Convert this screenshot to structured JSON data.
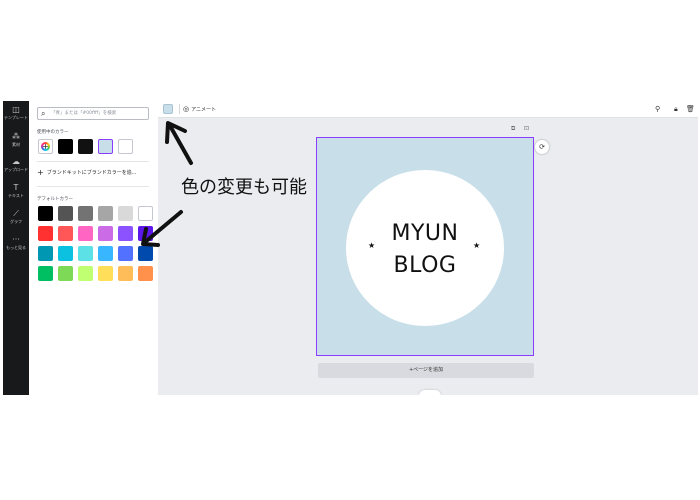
{
  "sidebar": {
    "items": [
      {
        "icon": "layout-icon",
        "glyph": "◫",
        "label": "テンプレート"
      },
      {
        "icon": "elements-icon",
        "glyph": "⁂",
        "label": "素材"
      },
      {
        "icon": "upload-icon",
        "glyph": "☁",
        "label": "アップロード"
      },
      {
        "icon": "text-icon",
        "glyph": "T",
        "label": "テキスト"
      },
      {
        "icon": "chart-icon",
        "glyph": "⟋",
        "label": "グラフ"
      },
      {
        "icon": "more-icon",
        "glyph": "···",
        "label": "もっと見る"
      }
    ]
  },
  "panel": {
    "search_placeholder": "「青」または「#00ffff」を検索",
    "used_colors_title": "使用中のカラー",
    "used_colors": [
      "#000000",
      "#111111",
      "#c8dfe9",
      "#ffffff"
    ],
    "brand_kit_label": "ブランドキットにブランドカラーを追...",
    "default_colors_title": "デフォルトカラー",
    "default_colors": [
      [
        "#000000",
        "#545454",
        "#737373",
        "#a6a6a6",
        "#d9d9d9",
        "#ffffff"
      ],
      [
        "#ff3131",
        "#ff5757",
        "#ff66c4",
        "#cb6ce6",
        "#8c52ff",
        "#5e17eb"
      ],
      [
        "#0097b2",
        "#0cc0df",
        "#5ce1e6",
        "#38b6ff",
        "#5271ff",
        "#004aad"
      ],
      [
        "#00bf63",
        "#7ed957",
        "#c1ff72",
        "#ffde59",
        "#ffbd59",
        "#ff914d"
      ]
    ]
  },
  "toolbar": {
    "current_color": "#c8dfe9",
    "animate_label": "アニメート"
  },
  "canvas": {
    "background": "#c8dfe9",
    "logo_line1": "MYUN",
    "logo_line2": "BLOG",
    "add_page_label": "+ページを追加"
  },
  "annotation": {
    "text": "色の変更も可能"
  }
}
